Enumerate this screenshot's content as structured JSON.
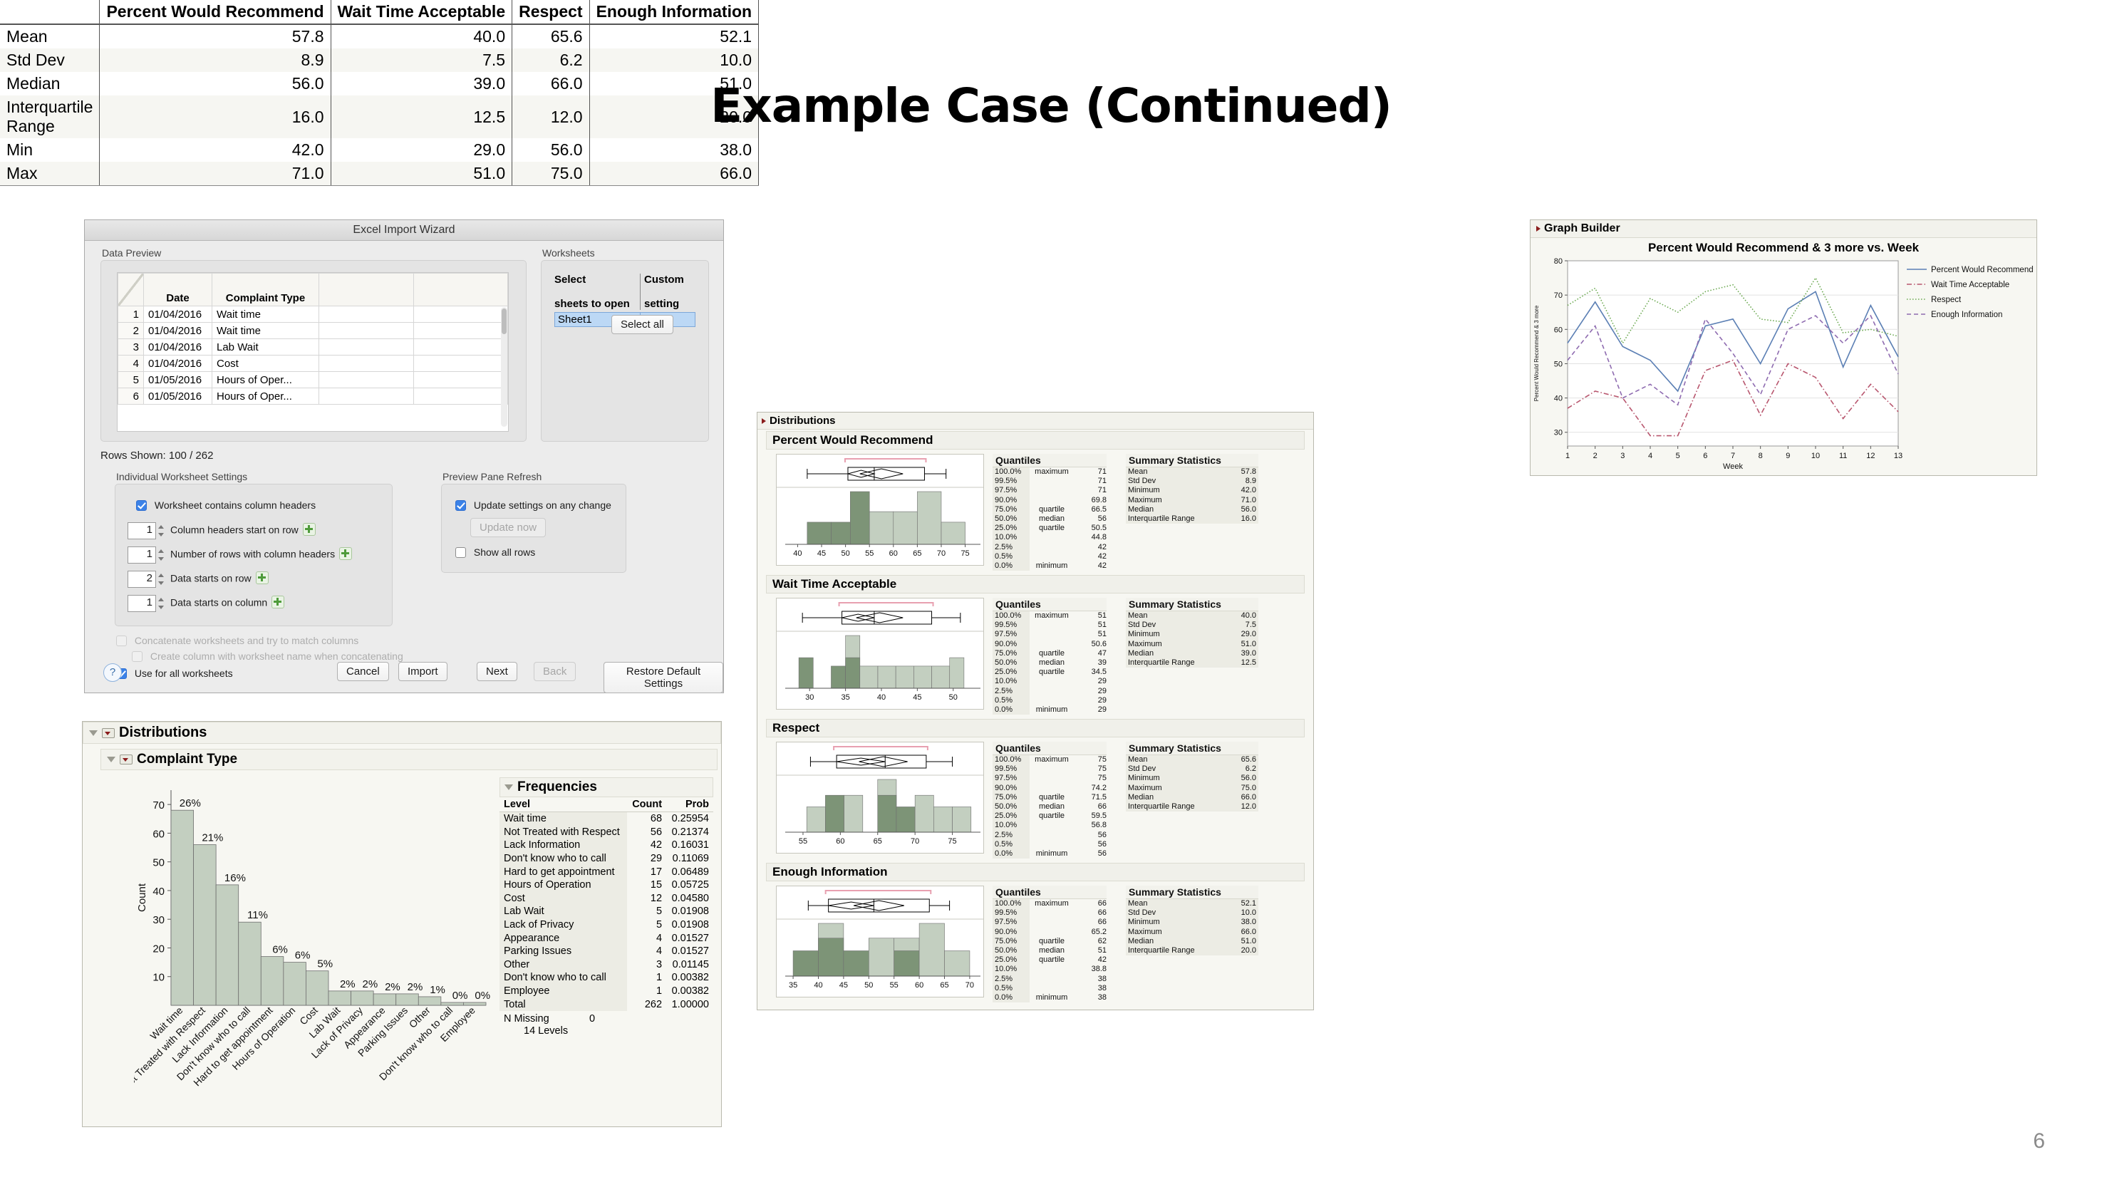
{
  "slide": {
    "title": "Example Case (Continued)",
    "page_number": "6"
  },
  "wizard": {
    "window_title": "Excel Import Wizard",
    "data_preview_label": "Data Preview",
    "worksheets_label": "Worksheets",
    "preview_columns": [
      "Date",
      "Complaint Type"
    ],
    "preview_rows": [
      {
        "n": "1",
        "date": "01/04/2016",
        "type": "Wait time"
      },
      {
        "n": "2",
        "date": "01/04/2016",
        "type": "Wait time"
      },
      {
        "n": "3",
        "date": "01/04/2016",
        "type": "Lab Wait"
      },
      {
        "n": "4",
        "date": "01/04/2016",
        "type": "Cost"
      },
      {
        "n": "5",
        "date": "01/05/2016",
        "type": "Hours of Oper..."
      },
      {
        "n": "6",
        "date": "01/05/2016",
        "type": "Hours of Oper..."
      }
    ],
    "ws_col1_line1": "Select",
    "ws_col1_line2": "sheets to open",
    "ws_col2_line1": "Custom",
    "ws_col2_line2": "setting",
    "ws_sheet_name": "Sheet1",
    "select_all_label": "Select all",
    "rows_shown": "Rows Shown: 100 / 262",
    "iws_label": "Individual Worksheet Settings",
    "ppr_label": "Preview Pane Refresh",
    "chk_headers": "Worksheet contains column headers",
    "spin_rows": [
      {
        "value": "1",
        "label": "Column headers start on row"
      },
      {
        "value": "1",
        "label": "Number of rows with column headers"
      },
      {
        "value": "2",
        "label": "Data starts on row"
      },
      {
        "value": "1",
        "label": "Data starts on column"
      }
    ],
    "chk_update": "Update settings on any change",
    "update_now_label": "Update now",
    "chk_showall": "Show all rows",
    "chk_concat": "Concatenate worksheets and try to match columns",
    "chk_createcol": "Create column with worksheet name when concatenating",
    "chk_useall": "Use for all worksheets",
    "help_label": "?",
    "buttons": {
      "cancel": "Cancel",
      "import": "Import",
      "next": "Next",
      "back": "Back",
      "restore": "Restore Default Settings"
    }
  },
  "summary_table": {
    "columns": [
      "Percent Would Recommend",
      "Wait Time Acceptable",
      "Respect",
      "Enough Information"
    ],
    "rows": [
      {
        "label": "Mean",
        "values": [
          "57.8",
          "40.0",
          "65.6",
          "52.1"
        ]
      },
      {
        "label": "Std Dev",
        "values": [
          "8.9",
          "7.5",
          "6.2",
          "10.0"
        ]
      },
      {
        "label": "Median",
        "values": [
          "56.0",
          "39.0",
          "66.0",
          "51.0"
        ]
      },
      {
        "label": "Interquartile Range",
        "values": [
          "16.0",
          "12.5",
          "12.0",
          "20.0"
        ]
      },
      {
        "label": "Min",
        "values": [
          "42.0",
          "29.0",
          "56.0",
          "38.0"
        ]
      },
      {
        "label": "Max",
        "values": [
          "71.0",
          "51.0",
          "75.0",
          "66.0"
        ]
      }
    ]
  },
  "distributions": {
    "title": "Distributions",
    "quantiles_header": "Quantiles",
    "summary_header": "Summary Statistics",
    "percent_labels": [
      "100.0%",
      "99.5%",
      "97.5%",
      "90.0%",
      "75.0%",
      "50.0%",
      "25.0%",
      "10.0%",
      "2.5%",
      "0.5%",
      "0.0%"
    ],
    "tags": [
      "maximum",
      "",
      "",
      "",
      "quartile",
      "median",
      "quartile",
      "",
      "",
      "",
      "minimum"
    ],
    "stat_names": [
      "Mean",
      "Std Dev",
      "Minimum",
      "Maximum",
      "Median",
      "Interquartile Range"
    ],
    "sections": [
      {
        "name": "Percent Would Recommend",
        "quantile_values": [
          "71",
          "71",
          "71",
          "69.8",
          "66.5",
          "56",
          "50.5",
          "44.8",
          "42",
          "42",
          "42"
        ],
        "stat_values": [
          "57.8",
          "8.9",
          "42.0",
          "71.0",
          "56.0",
          "16.0"
        ],
        "axis_ticks": [
          "40",
          "45",
          "50",
          "55",
          "60",
          "65",
          "70",
          "75"
        ],
        "axis_min": 38,
        "axis_max": 77,
        "bins": [
          {
            "x0": 42,
            "x1": 47,
            "h": 0.42,
            "dark": true
          },
          {
            "x0": 47,
            "x1": 51,
            "h": 0.42,
            "dark": true
          },
          {
            "x0": 51,
            "x1": 55,
            "h": 1.0,
            "dark": true
          },
          {
            "x0": 55,
            "x1": 60,
            "h": 0.62,
            "dark": false
          },
          {
            "x0": 60,
            "x1": 65,
            "h": 0.62,
            "dark": false
          },
          {
            "x0": 65,
            "x1": 70,
            "h": 1.0,
            "dark": false
          },
          {
            "x0": 70,
            "x1": 75,
            "h": 0.42,
            "dark": false
          }
        ],
        "box": {
          "min": 42,
          "q1": 50.5,
          "med": 56,
          "q3": 66.5,
          "max": 71,
          "mean_lo": 53,
          "mean_hi": 62
        }
      },
      {
        "name": "Wait Time Acceptable",
        "quantile_values": [
          "51",
          "51",
          "51",
          "50.6",
          "47",
          "39",
          "34.5",
          "29",
          "29",
          "29",
          "29"
        ],
        "stat_values": [
          "40.0",
          "7.5",
          "29.0",
          "51.0",
          "39.0",
          "12.5"
        ],
        "axis_ticks": [
          "30",
          "35",
          "40",
          "45",
          "50"
        ],
        "axis_min": 27,
        "axis_max": 53,
        "bins": [
          {
            "x0": 28.5,
            "x1": 30.5,
            "h": 0.58,
            "dark": true
          },
          {
            "x0": 33,
            "x1": 35,
            "h": 0.42,
            "dark": true
          },
          {
            "x0": 35,
            "x1": 37,
            "h": 1.0,
            "dark": false
          },
          {
            "x0": 35,
            "x1": 37,
            "h": 0.58,
            "dark": true
          },
          {
            "x0": 37,
            "x1": 39.5,
            "h": 0.42,
            "dark": false
          },
          {
            "x0": 39.5,
            "x1": 42,
            "h": 0.42,
            "dark": false
          },
          {
            "x0": 42,
            "x1": 44.5,
            "h": 0.42,
            "dark": false
          },
          {
            "x0": 44.5,
            "x1": 47,
            "h": 0.42,
            "dark": false
          },
          {
            "x0": 47,
            "x1": 49.5,
            "h": 0.42,
            "dark": false
          },
          {
            "x0": 49.5,
            "x1": 51.5,
            "h": 0.58,
            "dark": false
          }
        ],
        "box": {
          "min": 29,
          "q1": 34.5,
          "med": 39,
          "q3": 47,
          "max": 51,
          "mean_lo": 36.5,
          "mean_hi": 43
        }
      },
      {
        "name": "Respect",
        "quantile_values": [
          "75",
          "75",
          "75",
          "74.2",
          "71.5",
          "66",
          "59.5",
          "56.8",
          "56",
          "56",
          "56"
        ],
        "stat_values": [
          "65.6",
          "6.2",
          "56.0",
          "75.0",
          "66.0",
          "12.0"
        ],
        "axis_ticks": [
          "55",
          "60",
          "65",
          "70",
          "75"
        ],
        "axis_min": 53,
        "axis_max": 78,
        "bins": [
          {
            "x0": 55.5,
            "x1": 58,
            "h": 0.48,
            "dark": false
          },
          {
            "x0": 58,
            "x1": 60.5,
            "h": 0.7,
            "dark": true
          },
          {
            "x0": 60.5,
            "x1": 63,
            "h": 0.7,
            "dark": false
          },
          {
            "x0": 65,
            "x1": 67.5,
            "h": 1.0,
            "dark": false
          },
          {
            "x0": 65,
            "x1": 67.5,
            "h": 0.7,
            "dark": true
          },
          {
            "x0": 67.5,
            "x1": 70,
            "h": 0.48,
            "dark": true
          },
          {
            "x0": 70,
            "x1": 72.5,
            "h": 0.7,
            "dark": false
          },
          {
            "x0": 72.5,
            "x1": 75,
            "h": 0.48,
            "dark": false
          },
          {
            "x0": 75,
            "x1": 77.5,
            "h": 0.48,
            "dark": false
          }
        ],
        "box": {
          "min": 56,
          "q1": 59.5,
          "med": 66,
          "q3": 71.5,
          "max": 75,
          "mean_lo": 62.5,
          "mean_hi": 69
        }
      },
      {
        "name": "Enough Information",
        "quantile_values": [
          "66",
          "66",
          "66",
          "65.2",
          "62",
          "51",
          "42",
          "38.8",
          "38",
          "38",
          "38"
        ],
        "stat_values": [
          "52.1",
          "10.0",
          "38.0",
          "66.0",
          "51.0",
          "20.0"
        ],
        "axis_ticks": [
          "35",
          "40",
          "45",
          "50",
          "55",
          "60",
          "65",
          "70"
        ],
        "axis_min": 34,
        "axis_max": 71,
        "bins": [
          {
            "x0": 35,
            "x1": 40,
            "h": 0.48,
            "dark": true
          },
          {
            "x0": 40,
            "x1": 45,
            "h": 1.0,
            "dark": false
          },
          {
            "x0": 40,
            "x1": 45,
            "h": 0.72,
            "dark": true
          },
          {
            "x0": 45,
            "x1": 50,
            "h": 0.48,
            "dark": true
          },
          {
            "x0": 50,
            "x1": 55,
            "h": 0.72,
            "dark": false
          },
          {
            "x0": 55,
            "x1": 60,
            "h": 0.72,
            "dark": false
          },
          {
            "x0": 55,
            "x1": 60,
            "h": 0.48,
            "dark": true
          },
          {
            "x0": 60,
            "x1": 65,
            "h": 1.0,
            "dark": false
          },
          {
            "x0": 65,
            "x1": 70,
            "h": 0.48,
            "dark": false
          }
        ],
        "box": {
          "min": 38,
          "q1": 42,
          "med": 51,
          "q3": 62,
          "max": 66,
          "mean_lo": 47,
          "mean_hi": 57
        }
      }
    ]
  },
  "complaint_distributions": {
    "title": "Distributions",
    "variable": "Complaint Type",
    "frequencies_title": "Frequencies",
    "columns": [
      "Level",
      "Count",
      "Prob"
    ],
    "rows": [
      {
        "level": "Wait time",
        "count": "68",
        "prob": "0.25954"
      },
      {
        "level": "Not Treated with Respect",
        "count": "56",
        "prob": "0.21374"
      },
      {
        "level": "Lack Information",
        "count": "42",
        "prob": "0.16031"
      },
      {
        "level": "Don't know who to call",
        "count": "29",
        "prob": "0.11069"
      },
      {
        "level": "Hard to get appointment",
        "count": "17",
        "prob": "0.06489"
      },
      {
        "level": "Hours of Operation",
        "count": "15",
        "prob": "0.05725"
      },
      {
        "level": "Cost",
        "count": "12",
        "prob": "0.04580"
      },
      {
        "level": "Lab Wait",
        "count": "5",
        "prob": "0.01908"
      },
      {
        "level": "Lack of Privacy",
        "count": "5",
        "prob": "0.01908"
      },
      {
        "level": "Appearance",
        "count": "4",
        "prob": "0.01527"
      },
      {
        "level": "Parking Issues",
        "count": "4",
        "prob": "0.01527"
      },
      {
        "level": "Other",
        "count": "3",
        "prob": "0.01145"
      },
      {
        "level": "Don't know who to call",
        "count": "1",
        "prob": "0.00382"
      },
      {
        "level": "Employee",
        "count": "1",
        "prob": "0.00382"
      }
    ],
    "total": {
      "label": "Total",
      "count": "262",
      "prob": "1.00000"
    },
    "n_missing_label": "N Missing",
    "n_missing_value": "0",
    "levels_count": "14",
    "levels_label": "Levels"
  },
  "graph_builder": {
    "panel_title": "Graph Builder",
    "legend_position": "right"
  },
  "chart_data": [
    {
      "type": "bar",
      "title": "",
      "xlabel": "",
      "ylabel": "Count",
      "ylim": [
        0,
        75
      ],
      "yticks": [
        10,
        20,
        30,
        40,
        50,
        60,
        70
      ],
      "categories": [
        "Wait time",
        "Not Treated with Respect",
        "Lack Information",
        "Don't know who to call",
        "Hard to get appointment",
        "Hours of Operation",
        "Cost",
        "Lab Wait",
        "Lack of Privacy",
        "Appearance",
        "Parking Issues",
        "Other",
        "Don't know who to call",
        "Employee"
      ],
      "values": [
        68,
        56,
        42,
        29,
        17,
        15,
        12,
        5,
        5,
        4,
        4,
        3,
        1,
        1
      ],
      "data_labels": [
        "26%",
        "21%",
        "16%",
        "11%",
        "6%",
        "6%",
        "5%",
        "2%",
        "2%",
        "2%",
        "2%",
        "1%",
        "0%",
        "0%"
      ],
      "bar_color": "#c3cfc0",
      "grid": false
    },
    {
      "type": "line",
      "title": "Percent Would Recommend & 3 more vs. Week",
      "xlabel": "Week",
      "ylabel": "Percent Would Recommend & 3 more",
      "x": [
        1,
        2,
        3,
        4,
        5,
        6,
        7,
        8,
        9,
        10,
        11,
        12,
        13
      ],
      "xticks": [
        "1",
        "2",
        "3",
        "4",
        "5",
        "6",
        "7",
        "8",
        "9",
        "10",
        "11",
        "12",
        "13"
      ],
      "ylim": [
        26,
        80
      ],
      "yticks": [
        30,
        40,
        50,
        60,
        70,
        80
      ],
      "grid": true,
      "series": [
        {
          "name": "Percent Would Recommend",
          "color": "#5b7fb4",
          "dash": "none",
          "values": [
            56,
            68,
            55,
            51,
            42,
            61,
            63,
            50,
            66,
            71,
            49,
            67,
            52
          ]
        },
        {
          "name": "Wait Time Acceptable",
          "color": "#b8566e",
          "dash": "dashdot",
          "values": [
            37,
            42,
            40,
            29,
            29,
            48,
            51,
            35,
            50,
            46,
            34,
            44,
            36
          ]
        },
        {
          "name": "Respect",
          "color": "#6aa84f",
          "dash": "dot",
          "values": [
            67,
            72,
            56,
            69,
            65,
            71,
            73,
            63,
            62,
            75,
            59,
            60,
            58
          ]
        },
        {
          "name": "Enough Information",
          "color": "#8e6bb0",
          "dash": "dash",
          "values": [
            51,
            61,
            40,
            44,
            38,
            63,
            53,
            41,
            60,
            64,
            56,
            64,
            47
          ]
        }
      ]
    }
  ]
}
